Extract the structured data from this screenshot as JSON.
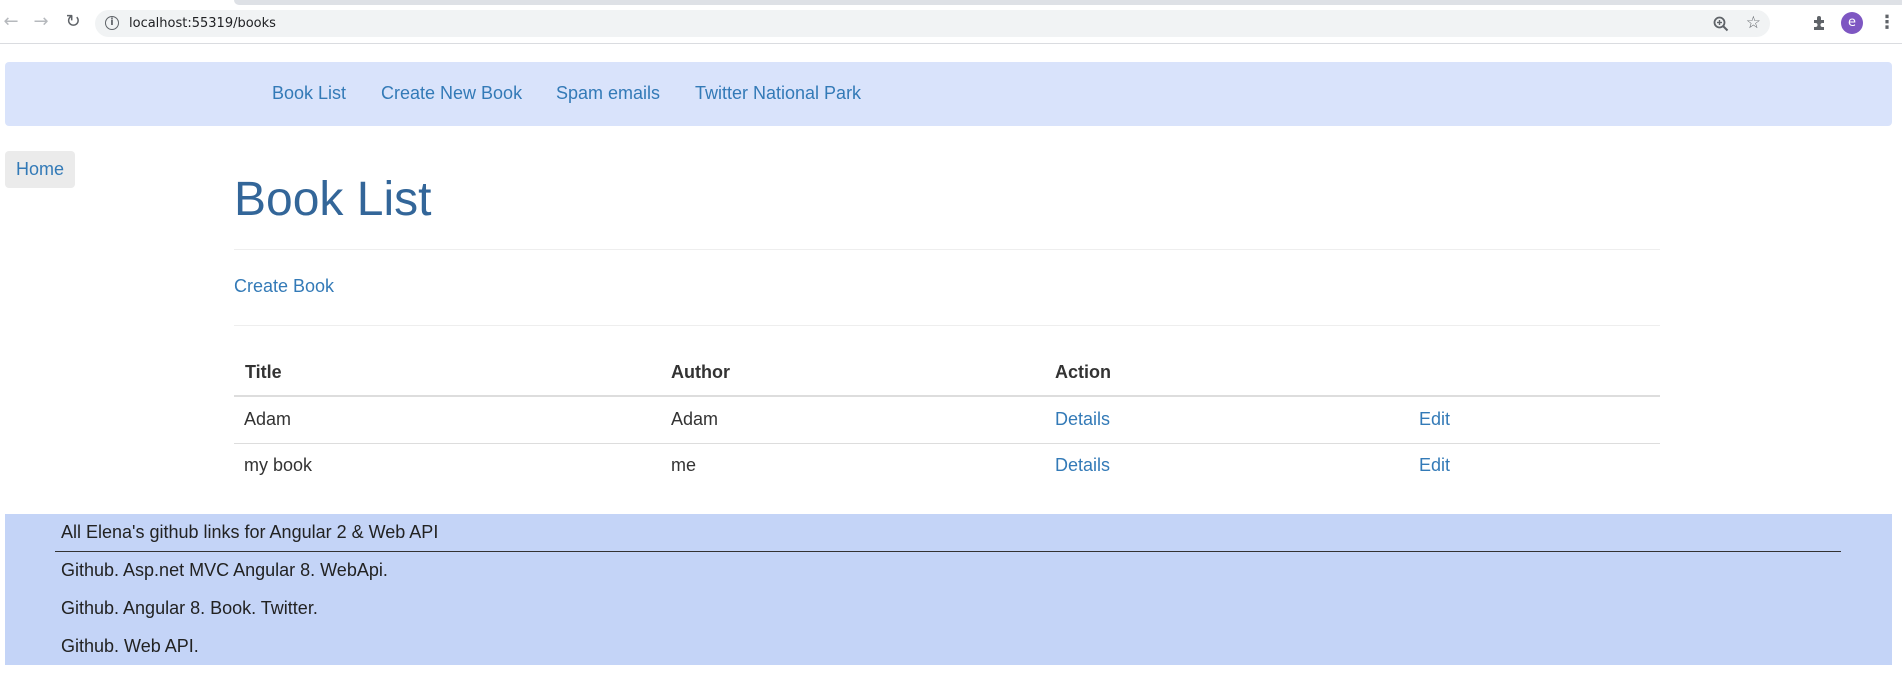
{
  "browser": {
    "url": "localhost:55319/books",
    "avatar_letter": "e",
    "icons": [
      "back-arrow-icon",
      "forward-arrow-icon",
      "reload-icon",
      "info-icon",
      "zoom-icon",
      "star-icon",
      "extensions-icon",
      "menu-icon"
    ]
  },
  "navbar": {
    "items": [
      {
        "label": "Book List"
      },
      {
        "label": "Create New Book"
      },
      {
        "label": "Spam emails"
      },
      {
        "label": "Twitter National Park"
      }
    ]
  },
  "home": {
    "label": "Home"
  },
  "page": {
    "title": "Book List",
    "create_link": "Create Book"
  },
  "table": {
    "headers": [
      "Title",
      "Author",
      "Action"
    ],
    "rows": [
      {
        "title": "Adam",
        "author": "Adam",
        "details": "Details",
        "edit": "Edit"
      },
      {
        "title": "my book",
        "author": "me",
        "details": "Details",
        "edit": "Edit"
      }
    ]
  },
  "footer": {
    "heading": "All Elena's github links for Angular 2 & Web API",
    "links": [
      {
        "label": "Github. Asp.net MVC Angular 8. WebApi."
      },
      {
        "label": "Github. Angular 8. Book. Twitter."
      },
      {
        "label": "Github. Web API."
      }
    ]
  },
  "colors": {
    "navbar_bg": "#d9e3fb",
    "footer_bg": "#c4d4f7",
    "link": "#337ab7",
    "title": "#336699"
  }
}
